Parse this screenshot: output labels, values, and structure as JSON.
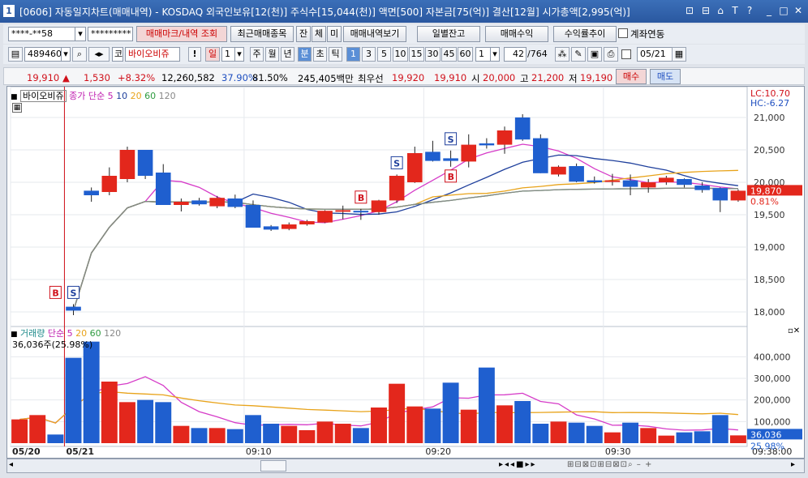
{
  "titlebar": {
    "window_num": "1",
    "title": "[0606] 자동일지차트(매매내역) - KOSDAQ 외국인보유[12(천)] 주식수[15,044(천)] 액면[500] 자본금[75(억)] 결산[12월] 시가총액[2,995(억)]",
    "buttons": [
      "⊡",
      "⊟",
      "⌂",
      "T",
      "?",
      "_",
      "□",
      "✕"
    ]
  },
  "toolbar1": {
    "account": "****-**58",
    "password": "*********",
    "btn_trade_mark": "매매마크/내역 조회",
    "btn_recent": "최근매매종목",
    "btn_jan": "잔",
    "btn_che": "체",
    "btn_mi": "미",
    "btn_history": "매매내역보기",
    "btn_daily_balance": "일별잔고",
    "btn_trade_profit": "매매수익",
    "btn_profit_trend": "수익률추이",
    "chk_account_link": "계좌연동"
  },
  "toolbar2": {
    "code": "489460",
    "market": "코",
    "stock_name": "바이오비쥬",
    "period_il": "일",
    "period_num": "1",
    "periods": [
      "주",
      "월",
      "년",
      "분",
      "초",
      "틱"
    ],
    "minutes": [
      "1",
      "3",
      "5",
      "10",
      "15",
      "30",
      "45",
      "60"
    ],
    "interval": "1",
    "count": "42",
    "total": "/764",
    "date": "05/21"
  },
  "quote": {
    "price": "19,910",
    "arrow": "▲",
    "change": "1,530",
    "rate": "+8.32%",
    "volume": "12,260,582",
    "turnover": "37.90%",
    "ratio": "81.50%",
    "amount": "245,405백만",
    "best_label": "최우선",
    "best_ask": "19,920",
    "best_bid": "19,910",
    "open_label": "시",
    "open": "20,000",
    "high_label": "고",
    "high": "21,200",
    "low_label": "저",
    "low": "19,190",
    "buy": "매수",
    "sell": "매도"
  },
  "price_legend": {
    "name": "바이오비쥬",
    "ma_label": "종가 단순",
    "ma": [
      "5",
      "10",
      "20",
      "60",
      "120"
    ]
  },
  "lc_hc": {
    "lc": "LC:10.70",
    "hc": "HC:-6.27"
  },
  "price_axis": [
    "21,000",
    "20,500",
    "20,000",
    "19,500",
    "19,000",
    "18,500",
    "18,000"
  ],
  "current_price_tag": "19,870",
  "current_rate_tag": "0.81%",
  "volume_legend": {
    "label": "거래량",
    "ma_label": "단순",
    "ma": [
      "5",
      "20",
      "60",
      "120"
    ],
    "value": "36,036주(25.98%)"
  },
  "volume_axis": [
    "400,000",
    "300,000",
    "200,000",
    "100,000"
  ],
  "volume_tag": "36,036",
  "volume_rate_tag": "25.98%",
  "time_axis": [
    "05/20",
    "05/21",
    "09:10",
    "09:20",
    "09:30",
    "09:38:00"
  ],
  "markers": [
    "S",
    "B",
    "S",
    "S",
    "B",
    "B"
  ],
  "colors": {
    "up": "#e3271c",
    "down": "#1f5fcf",
    "ma5": "#d63cc8",
    "ma10": "#1e3f9c",
    "ma20": "#e8a31a",
    "ma60": "#2e9b3f",
    "ma120": "#888888"
  },
  "chart_data": {
    "type": "candlestick",
    "candles": [
      {
        "o": 18080,
        "h": 18120,
        "l": 17950,
        "c": 18020
      },
      {
        "o": 19870,
        "h": 19920,
        "l": 19700,
        "c": 19800
      },
      {
        "o": 19850,
        "h": 20230,
        "l": 19800,
        "c": 20100
      },
      {
        "o": 20050,
        "h": 20550,
        "l": 20000,
        "c": 20500
      },
      {
        "o": 20500,
        "h": 20500,
        "l": 20050,
        "c": 20100
      },
      {
        "o": 20150,
        "h": 20280,
        "l": 19650,
        "c": 19650
      },
      {
        "o": 19650,
        "h": 19750,
        "l": 19550,
        "c": 19700
      },
      {
        "o": 19720,
        "h": 19760,
        "l": 19640,
        "c": 19660
      },
      {
        "o": 19630,
        "h": 19790,
        "l": 19600,
        "c": 19760
      },
      {
        "o": 19750,
        "h": 19810,
        "l": 19600,
        "c": 19620
      },
      {
        "o": 19650,
        "h": 19720,
        "l": 19300,
        "c": 19300
      },
      {
        "o": 19320,
        "h": 19340,
        "l": 19250,
        "c": 19270
      },
      {
        "o": 19280,
        "h": 19380,
        "l": 19260,
        "c": 19350
      },
      {
        "o": 19350,
        "h": 19420,
        "l": 19330,
        "c": 19400
      },
      {
        "o": 19380,
        "h": 19570,
        "l": 19370,
        "c": 19560
      },
      {
        "o": 19550,
        "h": 19640,
        "l": 19430,
        "c": 19570
      },
      {
        "o": 19560,
        "h": 19590,
        "l": 19420,
        "c": 19550
      },
      {
        "o": 19540,
        "h": 19730,
        "l": 19500,
        "c": 19720
      },
      {
        "o": 19720,
        "h": 20120,
        "l": 19680,
        "c": 20100
      },
      {
        "o": 20000,
        "h": 20550,
        "l": 19990,
        "c": 20450
      },
      {
        "o": 20470,
        "h": 20640,
        "l": 20320,
        "c": 20330
      },
      {
        "o": 20370,
        "h": 20490,
        "l": 20240,
        "c": 20330
      },
      {
        "o": 20320,
        "h": 20740,
        "l": 20230,
        "c": 20580
      },
      {
        "o": 20600,
        "h": 20680,
        "l": 20520,
        "c": 20570
      },
      {
        "o": 20580,
        "h": 20860,
        "l": 20440,
        "c": 20800
      },
      {
        "o": 21000,
        "h": 21050,
        "l": 20640,
        "c": 20660
      },
      {
        "o": 20680,
        "h": 20740,
        "l": 20140,
        "c": 20140
      },
      {
        "o": 20120,
        "h": 20260,
        "l": 20090,
        "c": 20240
      },
      {
        "o": 20250,
        "h": 20290,
        "l": 20000,
        "c": 20010
      },
      {
        "o": 20030,
        "h": 20090,
        "l": 19980,
        "c": 20000
      },
      {
        "o": 20010,
        "h": 20130,
        "l": 19950,
        "c": 20030
      },
      {
        "o": 20030,
        "h": 20120,
        "l": 19800,
        "c": 19930
      },
      {
        "o": 19920,
        "h": 20050,
        "l": 19840,
        "c": 20000
      },
      {
        "o": 20000,
        "h": 20100,
        "l": 19960,
        "c": 20070
      },
      {
        "o": 20050,
        "h": 20060,
        "l": 19920,
        "c": 19960
      },
      {
        "o": 19950,
        "h": 20000,
        "l": 19840,
        "c": 19880
      },
      {
        "o": 19910,
        "h": 19920,
        "l": 19540,
        "c": 19720
      },
      {
        "o": 19720,
        "h": 19890,
        "l": 19700,
        "c": 19870
      }
    ],
    "volume": [
      110000,
      130000,
      40000,
      395000,
      470000,
      285000,
      190000,
      200000,
      190000,
      80000,
      70000,
      70000,
      65000,
      130000,
      90000,
      80000,
      60000,
      100000,
      90000,
      70000,
      165000,
      275000,
      170000,
      160000,
      280000,
      155000,
      350000,
      175000,
      195000,
      90000,
      100000,
      95000,
      80000,
      50000,
      95000,
      70000,
      35000,
      50000,
      55000,
      130000,
      36036
    ],
    "ylim": [
      17800,
      21300
    ],
    "vol_ylim": [
      0,
      480000
    ]
  }
}
